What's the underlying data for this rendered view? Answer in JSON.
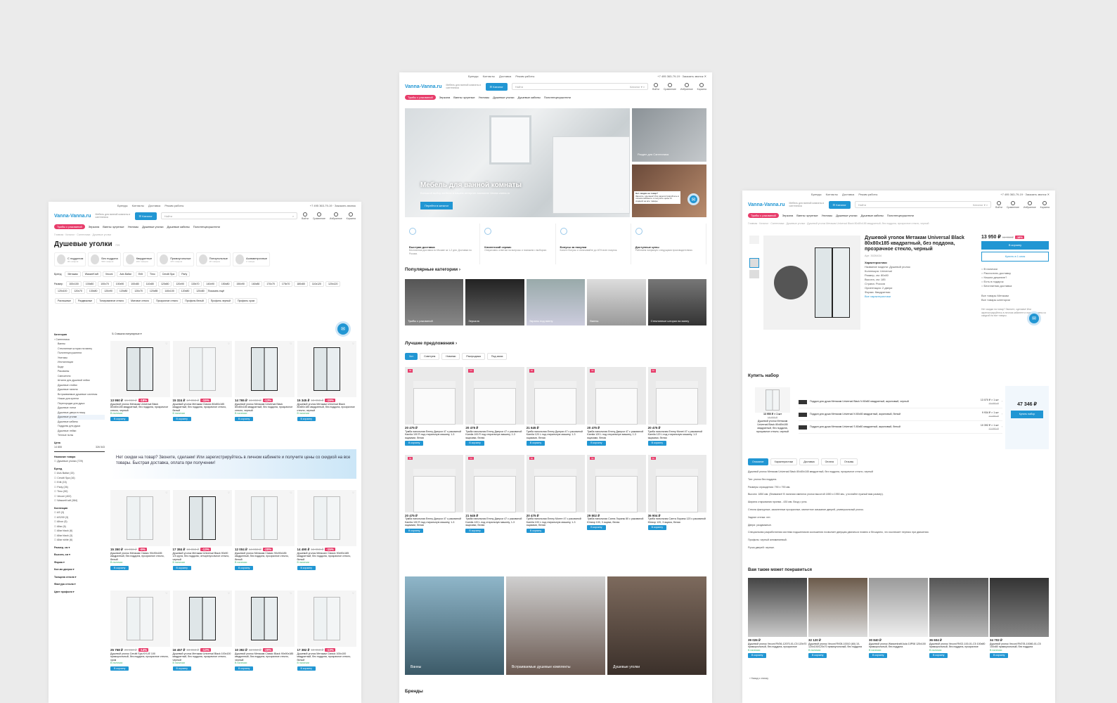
{
  "site": {
    "logo": "Vanna-Vanna.ru",
    "tagline": "Мебель для ванной комнаты и сантехника",
    "phone": "+7 495 363-79-19",
    "callback": "Заказать звонок",
    "toplinks": [
      "Бренды",
      "Контакты",
      "Доставка",
      "Режим работы"
    ],
    "catalog_btn": "Каталог",
    "search_placeholder": "Найти",
    "search_scope": "Каталог",
    "header_icons": [
      "Войти",
      "Сравнение",
      "Избранное",
      "Корзина"
    ],
    "nav": [
      "Тумбы с раковиной",
      "Зеркала",
      "Ванны чугунные",
      "Унитазы",
      "Душевые уголки",
      "Душевые кабины",
      "Полотенцесушители"
    ]
  },
  "catalog_page": {
    "breadcrumb": "Главная  ·  Каталог  ·  Сантехника  ·  Душевые уголки",
    "title": "Душевые уголки",
    "count": "729",
    "types": [
      {
        "name": "С поддоном",
        "count": "96 товаров"
      },
      {
        "name": "Без поддона",
        "count": "580 товаров"
      },
      {
        "name": "Квадратные",
        "count": "220 товаров"
      },
      {
        "name": "Прямоугольные",
        "count": "476 товаров"
      },
      {
        "name": "Пятиугольные",
        "count": "28 товаров"
      },
      {
        "name": "Асимметричные",
        "count": "3 товара"
      }
    ],
    "brand_label": "Бренд",
    "brands": [
      "Метакам",
      "WasserKraft",
      "Veconi",
      "Avis Baltar",
      "Erlit",
      "Timo",
      "Cerutti Spa",
      "Parly"
    ],
    "size_label": "Размер",
    "sizes": [
      "100х100",
      "100х80",
      "100х70",
      "100х90",
      "100х80",
      "110х80",
      "120х80",
      "120х90",
      "130х70",
      "140х90",
      "150х80",
      "150х90",
      "160х80",
      "170х70",
      "175х70",
      "180х80",
      "110х120",
      "120х120",
      "120х100",
      "120х70",
      "130х80",
      "120х90",
      "120х80",
      "120х70",
      "120х85",
      "140х100",
      "120х80",
      "120х80"
    ],
    "size_more": "Показать ещё",
    "tags": [
      "Распашные",
      "Раздвижные",
      "Тонированное стекло",
      "Матовое стекло",
      "Прозрачное стекло",
      "Профиль белый",
      "Профиль черный",
      "Профиль хром"
    ],
    "sort": "Сначала популярные",
    "sidebar": {
      "categories_title": "Категория",
      "root": "Сантехника",
      "items": [
        "Ванны",
        "Стеклянные шторки на ванну",
        "Полотенцесушители",
        "Унитазы",
        "Инсталляции",
        "Биде",
        "Раковины",
        "Смесители",
        "Штанги для душевой лейки",
        "Душевые стойки",
        "Душевые панели",
        "Встраиваемые душевые системы",
        "Ножки для купели",
        "Перегородки для душа",
        "Душевые лотки",
        "Душевые двери в нишу",
        "Душевые уголки",
        "Душевые кабины",
        "Поддоны для душа",
        "Душевые лейки",
        "Теплые полы"
      ],
      "active_item": "Душевые уголки",
      "price_title": "Цена",
      "price_from": "14 855",
      "price_to": "326 543",
      "name_title": "Название товара",
      "name_option": "Душевые уголки (729)",
      "brand_title": "Бренд",
      "brand_options": [
        "Avis Baltar (15)",
        "Cerutti Spa (16)",
        "Erlit (15)",
        "Parly (26)",
        "Timo (50)",
        "Veconi (402)",
        "WasserKraft (384)"
      ],
      "coll_title": "Коллекция",
      "coll_options": [
        "AS (3)",
        "AS200 (3)",
        "Alhon (5)",
        "Altar (6)",
        "Altar black (6)",
        "Altar black (3)",
        "Altar white (6)"
      ],
      "filters": [
        "Размер, см",
        "Высота, см",
        "Форма",
        "Кол-во дверок",
        "Толщина стекла",
        "Фактура стекла",
        "Цвет профиля"
      ]
    },
    "products": [
      {
        "price": "13 950 ₽",
        "old": "16 950 ₽",
        "disc": "-18%",
        "name": "Душевой уголок Метакам Universal Black 80х80х185 квадратный, без поддона, прозрачное стекло, черный",
        "stock": "В наличии",
        "dark": true
      },
      {
        "price": "15 324 ₽",
        "old": "17 950 ₽",
        "disc": "-15%",
        "name": "Душевой уголок Метакам Classic 80х80х185 квадратный, без поддона, прозрачное стекло, белый",
        "stock": "В наличии",
        "dark": false
      },
      {
        "price": "14 765 ₽",
        "old": "16 950 ₽",
        "disc": "-13%",
        "name": "Душевой уголок Метакам Universal Black 80х80х185 квадратный, без поддона, прозрачное стекло, черный",
        "stock": "В наличии",
        "dark": true
      },
      {
        "price": "15 345 ₽",
        "old": "18 950 ₽",
        "disc": "-19%",
        "name": "Душевой уголок Метакам Universal Black 80х80х185 квадратный, без поддона, прозрачное стекло, черный",
        "stock": "В наличии",
        "dark": true
      },
      {
        "price": "15 350 ₽",
        "old": "16 950 ₽",
        "disc": "-9%",
        "name": "Душевой уголок Метакам Classic 90х90х185 квадратный, без поддона, прозрачное стекло, белый",
        "stock": "В наличии",
        "dark": false
      },
      {
        "price": "17 384 ₽",
        "old": "19 950 ₽",
        "disc": "-13%",
        "name": "Душевой уголок Метакам Universal Black 90х90 1/4 круга, без поддона, четырехугольное стекло, черный",
        "stock": "В наличии",
        "dark": true
      },
      {
        "price": "12 004 ₽",
        "old": "14 950 ₽",
        "disc": "-20%",
        "name": "Душевой уголок Метакам Classic 90х90х185 квадратный, без поддона, прозрачное стекло, белый",
        "stock": "В наличии",
        "dark": false
      },
      {
        "price": "14 490 ₽",
        "old": "16 950 ₽",
        "disc": "-15%",
        "name": "Душевой уголок Metacam Classic 90х90х185 квадратный, без поддона, прозрачное стекло, белый",
        "stock": "В наличии",
        "dark": false
      },
      {
        "price": "25 758 ₽",
        "old": "29 950 ₽",
        "disc": "-14%",
        "name": "Душевой уголок Cerutti Spa KYLIE 100 прямоугольный, без поддона, прозрачное стекло, хром",
        "stock": "В наличии",
        "dark": false
      },
      {
        "price": "16 457 ₽",
        "old": "18 950 ₽",
        "disc": "-13%",
        "name": "Душевой уголок Метакам Universal Black 100х100 квадратный, без поддона, прозрачное стекло, черный",
        "stock": "В наличии",
        "dark": true
      },
      {
        "price": "10 392 ₽",
        "old": "12 950 ₽",
        "disc": "-20%",
        "name": "Душевой уголок Метакам Classic Black 90х90х185 квадратный, без поддона, прозрачное стекло, черный",
        "stock": "В наличии",
        "dark": true
      },
      {
        "price": "17 382 ₽",
        "old": "19 950 ₽",
        "disc": "-13%",
        "name": "Душевой уголок Метакам Classic 100х100 квадратный, без поддона, прозрачное стекло, белый",
        "stock": "В наличии",
        "dark": false
      }
    ],
    "buy_label": "В корзину",
    "promo": "Нет скидки на товар? Звоните, сделаем! Или зарегистрируйтесь в личном кабинете и получите цены со скидкой на все товары. Быстрая доставка, оплата при получении!"
  },
  "home_page": {
    "hero_title": "Мебель для ванной комнаты",
    "hero_sub": "Большой выбор мебели в нашем интернет-магазине Vanna-vanna.ru",
    "hero_btn": "Перейти в каталог",
    "side1": "Раздел для Сантехника",
    "ask_title": "Нет скидки на товар?",
    "ask_text": "Звоните, сделаем! Или зарегистрируйтесь в личном кабинете и получите цены со скидкой на все товары.",
    "benefits": [
      {
        "title": "Быстрая доставка",
        "text": "Бесплатная доставка по Москве за 1-2 дня. Доставка по России."
      },
      {
        "title": "Клиентский сервис",
        "text": "Оперативно ответим на вопросы и поможем с выбором."
      },
      {
        "title": "Бонусы за покупки",
        "text": "Копите бонусы и оплачивайте до 40% всех покупок."
      },
      {
        "title": "Доступные цены",
        "text": "Работаем напрямую с ведущими производителями."
      }
    ],
    "popular_title": "Популярные категории",
    "popular": [
      "Тумбы с раковиной",
      "Зеркала",
      "Экраны под ванну",
      "Ванны",
      "Стеклянные шторки на ванну"
    ],
    "best_title": "Лучшие предложения",
    "best_tabs": [
      "Хит",
      "Советуем",
      "Новинки",
      "Распродажа",
      "Под заказ"
    ],
    "best_products": [
      {
        "price": "20 475 ₽",
        "name": "Тумба напольная Emmy Джерси 47 с раковиной Kamila 100 R под стиральную машину, 1-3 ящиками, белая"
      },
      {
        "price": "20 475 ₽",
        "name": "Тумба напольная Emmy Джерси 47 с раковиной Kamila 100 R под стиральную машину, 1-3 ящиками, белая"
      },
      {
        "price": "21 645 ₽",
        "name": "Тумба напольная Emmy Джерси 47 с раковиной Kamila 120 L под стиральную машину, 1-3 ящиками, белая"
      },
      {
        "price": "20 475 ₽",
        "name": "Тумба напольная Emmy Джерси 47 с раковиной Kamila 120 L под стиральную машину, 1-3 ящиками, белая"
      },
      {
        "price": "20 475 ₽",
        "name": "Тумба напольная Emmy Monet 47 с раковиной Kamila 120 L под стиральную машину, 1-3 ящиками, белая"
      },
      {
        "price": "20 475 ₽",
        "name": "Тумба напольная Emmy Джерси 47 с раковиной Kamila 100 R под стиральную машину, 1-3 ящиками, белая"
      },
      {
        "price": "21 645 ₽",
        "name": "Тумба напольная Emmy Джерси 47 с раковиной Kamila 120 L под стиральную машину, 1-3 ящиками, белая"
      },
      {
        "price": "20 475 ₽",
        "name": "Тумба напольная Emmy Монте 47 с раковиной Kamila 100 L под стиральную машину, 1-3 ящиками, белая"
      },
      {
        "price": "29 802 ₽",
        "name": "Тумба напольная Санта Лоранж 80 с раковиной Юниор 100, 3 ящика, белая"
      },
      {
        "price": "36 904 ₽",
        "name": "Тумба напольная Санта Лоранж 120 с раковиной Юниор 120, 3 ящика, белая"
      }
    ],
    "big": [
      "Ванны",
      "Встраиваемые душевые комплекты",
      "Душевые уголки"
    ],
    "brands_title": "Бренды"
  },
  "product_page": {
    "breadcrumb": "Главная  ·  Каталог  ·  Сантехника  ·  Душевые уголки  ·  Душевой уголок Метакам Universal Black 80х80х185 квадратный, без поддона, прозрачное стекло, черный",
    "title": "Душевой уголок Метакам Universal Black 80х80х185 квадратный, без поддона, прозрачное стекло, черный",
    "sku": "Арт. 3026434",
    "specs_title": "Характеристики",
    "specs": [
      "Название модели: Душевой уголок",
      "Коллекция: Universal",
      "Размер, см: 80х80",
      "Высота, см: 185",
      "Страна: Россия",
      "Ориентация: 2 двери",
      "Форма: Квадратная"
    ],
    "specs_all": "Все характеристики",
    "price": "13 950 ₽",
    "old": "16 950 ₽",
    "disc": "-18%",
    "cart": "В корзину",
    "oneclick": "Купить в 1 клик",
    "perks": [
      "В наличии",
      "Рассчитать доставку",
      "Нашли дешевле?",
      "Есть в подарок",
      "Бесплатная доставка"
    ],
    "brand_links": [
      "Все товары Метакам",
      "Все товары категории"
    ],
    "ask": "Нет скидки на товар? Звоните, сделаем! Или зарегистрируйтесь в личном кабинете и получите цены со скидкой на все товары.",
    "kit_title": "Купить набор",
    "kit_main": {
      "price": "13 950 ₽ × 1 шт",
      "old": "16 950 ₽",
      "name": "Душевой уголок Метакам Universal Black 80х80х185 квадратный, без поддона, прозрачное стекло, черный"
    },
    "kit_items": [
      {
        "name": "Поддон для душа Метакам Universal Black N 80х80 квадратный, акриловый, черный",
        "price": "13 070 ₽ × 1 шт",
        "old": "15 950 ₽"
      },
      {
        "name": "Поддон для душа Метакам Universal N 80х80 квадратный, акриловый, белый",
        "price": "9 934 ₽ × 1 шт",
        "old": "12 950 ₽"
      },
      {
        "name": "Поддон для душа Метакам Universal S 80х80 квадратный, акриловый, белый",
        "price": "10 392 ₽ × 1 шт",
        "old": "12 950 ₽"
      }
    ],
    "kit_total": "47 346 ₽",
    "kit_btn": "Купить набор",
    "tabs": [
      "Описание",
      "Характеристики",
      "Доставка",
      "Оплата",
      "Отзывы"
    ],
    "desc": [
      "Душевой уголок Метакам Universal Black 80х80х185 квадратный, без поддона, прозрачное стекло, черный",
      "Тип: уголок без поддона.",
      "Размеры ограждения: 790 х 790 мм.",
      "Высота: 1850 мм. (Внимание! В наличии имеются уголки высотой 1850 и 1950 мм., уточняйте нужный вам размер).",
      "Ширина открывания проема - 430 мм. Вход с угла.",
      "Стекла фактурные, закаленные прозрачные, магнитное смыкание дверей, универсальный уголок.",
      "Задние стенки: нет.",
      "Двери: раздвижные.",
      "Специальная разработанная система подшипников скольжения позволяет дверцам двигаться плавно и бесшумно, что исключает перекос при движении.",
      "Профиль: черный алюминиевый.",
      "Ручки дверей: черные."
    ],
    "similar_title": "Вам также может понравиться",
    "similar": [
      {
        "price": "39 026 ₽",
        "name": "Душевой уголок Veconi RV06-12070-01-C5 120х70 прямоугольный, без поддона, прозрачное"
      },
      {
        "price": "32 120 ₽",
        "name": "Душевой уголок Veconi RV08-10010 (60) 10-120х100/120х70 прямоугольный, без поддона"
      },
      {
        "price": "30 840 ₽",
        "name": "Душевой уголок Wasserkraft Aula 10P08 120х100 прямоугольный, без поддона"
      },
      {
        "price": "36 604 ₽",
        "name": "Душевой уголок Veconi RV02-100-01-C5 100х80 прямоугольный, без поддона, прозрачное"
      },
      {
        "price": "34 702 ₽",
        "name": "Душевой уголок Veconi RV078-10080-01-C5 100х80 прямоугольный, без поддона"
      }
    ],
    "back": "Назад к списку"
  },
  "colors": {
    "accent": "#2196d3",
    "badge": "#e73c6a",
    "stock": "#3cb26b",
    "background": "#ebebeb"
  }
}
